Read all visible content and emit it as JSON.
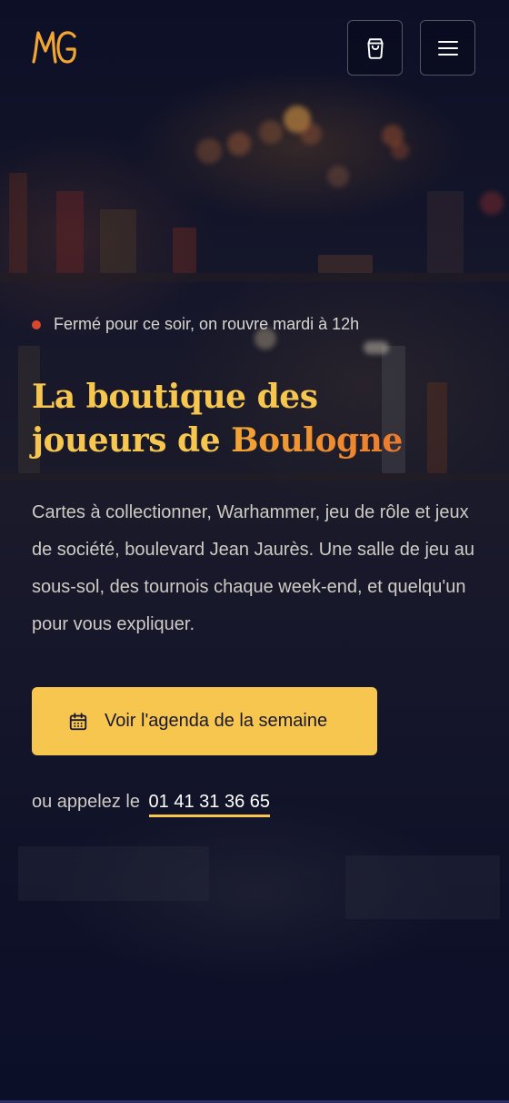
{
  "header": {
    "logo_text": "MG",
    "cart_icon": "shopping-bag-icon",
    "menu_icon": "hamburger-menu-icon"
  },
  "status": {
    "text": "Fermé pour ce soir, on rouvre mardi à 12h",
    "dot_color": "#d9472f"
  },
  "hero": {
    "title_line1": "La boutique des",
    "title_line2_part1": "joueurs de ",
    "title_line2_part2": "Boulogne",
    "intro": "Cartes à collectionner, Warhammer, jeu de rôle et jeux de société, boulevard Jean Jaurès. Une salle de jeu au sous-sol, des tournois chaque week-end, et quelqu'un pour vous expliquer.",
    "cta_label": "Voir l'agenda de la semaine",
    "cta_icon": "calendar-icon",
    "call_prefix": "ou appelez le",
    "phone": "01 41 31 36 65"
  },
  "colors": {
    "accent": "#f6c64e",
    "accent_orange": "#ec7a2d",
    "background": "#0d1027"
  }
}
